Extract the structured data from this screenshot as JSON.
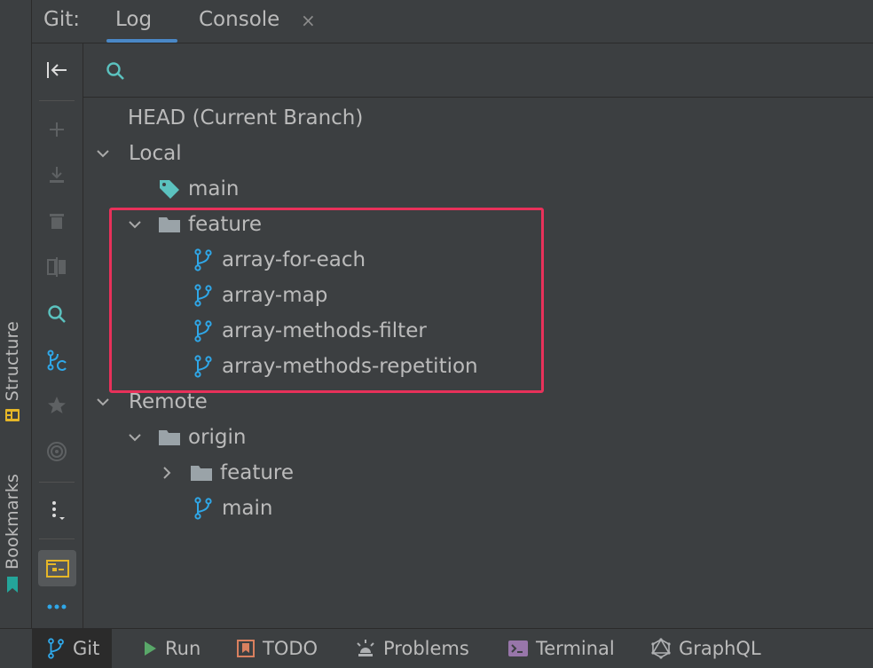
{
  "header": {
    "label": "Git:",
    "tabs": [
      {
        "label": "Log"
      },
      {
        "label": "Console",
        "close": "×"
      }
    ]
  },
  "search": {
    "value": "",
    "placeholder": ""
  },
  "tree": {
    "head": "HEAD (Current Branch)",
    "local": {
      "label": "Local",
      "main": "main",
      "feature": {
        "label": "feature",
        "branches": [
          "array-for-each",
          "array-map",
          "array-methods-filter",
          "array-methods-repetition"
        ]
      }
    },
    "remote": {
      "label": "Remote",
      "origin": {
        "label": "origin",
        "feature": "feature",
        "main": "main"
      }
    }
  },
  "sidebar_labels": {
    "structure": "Structure",
    "bookmarks": "Bookmarks"
  },
  "bottom_tabs": [
    "Git",
    "Run",
    "TODO",
    "Problems",
    "Terminal",
    "GraphQL"
  ],
  "colors": {
    "background": "#3c3f41",
    "branch_icon": "#2fa7e8",
    "tag_icon": "#5bc2bf",
    "folder_icon": "#9aa3a8",
    "highlight": "#e8315a",
    "tab_underline": "#4a88c7"
  },
  "icons": {
    "toolbar": [
      "collapse-to-left-icon",
      "plus-icon",
      "download-icon",
      "trash-icon",
      "compare-icon",
      "search-icon",
      "branch-search-icon",
      "star-icon",
      "target-icon",
      "more-vertical-icon",
      "layout-icon",
      "ellipsis-icon"
    ]
  }
}
